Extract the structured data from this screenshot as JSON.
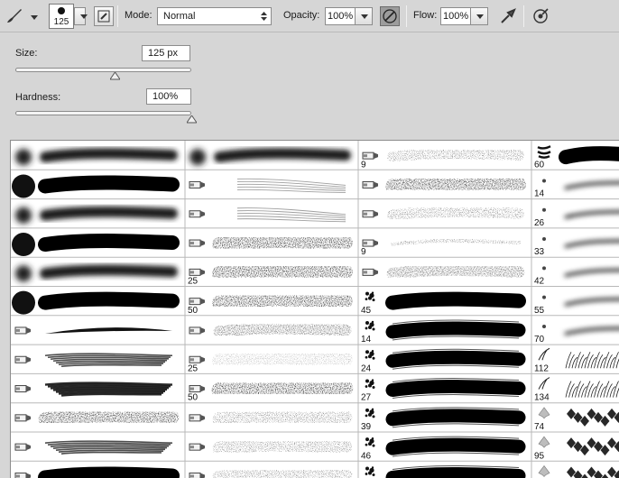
{
  "toolbar": {
    "brush_size": "125",
    "mode_label": "Mode:",
    "mode_value": "Normal",
    "opacity_label": "Opacity:",
    "opacity_value": "100%",
    "flow_label": "Flow:",
    "flow_value": "100%"
  },
  "panel": {
    "size_label": "Size:",
    "size_value": "125 px",
    "size_level": 125,
    "hardness_label": "Hardness:",
    "hardness_value": "100%",
    "hardness_level": 100
  },
  "brushes": {
    "columns": [
      [
        {
          "icon": "soft-round",
          "label": "",
          "stroke": "soft"
        },
        {
          "icon": "hard-round",
          "label": "",
          "stroke": "hard"
        },
        {
          "icon": "soft-round",
          "label": "",
          "stroke": "soft"
        },
        {
          "icon": "hard-round",
          "label": "",
          "stroke": "hard"
        },
        {
          "icon": "soft-round",
          "label": "",
          "stroke": "soft"
        },
        {
          "icon": "hard-round",
          "label": "",
          "stroke": "hard"
        },
        {
          "icon": "bristle-round",
          "label": "",
          "stroke": "taper"
        },
        {
          "icon": "bristle-flat",
          "label": "",
          "stroke": "streaky"
        },
        {
          "icon": "bristle-flat",
          "label": "",
          "stroke": "streaky-dark"
        },
        {
          "icon": "bristle-angle",
          "label": "",
          "stroke": "dry-dark"
        },
        {
          "icon": "bristle-fan",
          "label": "",
          "stroke": "streaky"
        },
        {
          "icon": "bristle-point",
          "label": "",
          "stroke": "hard"
        }
      ],
      [
        {
          "icon": "soft-round",
          "label": "",
          "stroke": "soft"
        },
        {
          "icon": "erodible-point",
          "label": "",
          "stroke": "faint-lines"
        },
        {
          "icon": "erodible-angle",
          "label": "",
          "stroke": "faint-lines"
        },
        {
          "icon": "airbrush",
          "label": "",
          "stroke": "rough"
        },
        {
          "icon": "airbrush",
          "label": "25",
          "stroke": "rough"
        },
        {
          "icon": "airbrush-angle",
          "label": "50",
          "stroke": "rough"
        },
        {
          "icon": "airbrush-angle",
          "label": "",
          "stroke": "light-rough"
        },
        {
          "icon": "airbrush-angle",
          "label": "25",
          "stroke": "speckle-light"
        },
        {
          "icon": "airbrush-angle",
          "label": "50",
          "stroke": "blotch"
        },
        {
          "icon": "airbrush-angle",
          "label": "",
          "stroke": "speckle"
        },
        {
          "icon": "airbrush-angle",
          "label": "",
          "stroke": "speckle"
        },
        {
          "icon": "airbrush-angle",
          "label": "",
          "stroke": "speckle"
        }
      ],
      [
        {
          "icon": "airbrush",
          "label": "9",
          "stroke": "textured"
        },
        {
          "icon": "airbrush",
          "label": "",
          "stroke": "rough"
        },
        {
          "icon": "airbrush",
          "label": "",
          "stroke": "textured"
        },
        {
          "icon": "airbrush",
          "label": "9",
          "stroke": "thin"
        },
        {
          "icon": "airbrush",
          "label": "",
          "stroke": "light-rough"
        },
        {
          "icon": "splatter",
          "label": "45",
          "stroke": "hard"
        },
        {
          "icon": "splatter",
          "label": "14",
          "stroke": "stroked-lines"
        },
        {
          "icon": "splatter",
          "label": "24",
          "stroke": "stroked-lines"
        },
        {
          "icon": "splatter",
          "label": "27",
          "stroke": "stroked-lines"
        },
        {
          "icon": "splatter",
          "label": "39",
          "stroke": "stroked-lines"
        },
        {
          "icon": "splatter",
          "label": "46",
          "stroke": "stroked-lines"
        },
        {
          "icon": "splatter",
          "label": "59",
          "stroke": "stroked-lines"
        }
      ],
      [
        {
          "icon": "texture",
          "label": "60",
          "stroke": "hard"
        },
        {
          "icon": "dot",
          "label": "14",
          "stroke": "thin-line"
        },
        {
          "icon": "dot",
          "label": "26",
          "stroke": "thin-line"
        },
        {
          "icon": "dot",
          "label": "33",
          "stroke": "thin-line"
        },
        {
          "icon": "dot",
          "label": "42",
          "stroke": "thin-line"
        },
        {
          "icon": "dot",
          "label": "55",
          "stroke": "thin-line"
        },
        {
          "icon": "dot",
          "label": "70",
          "stroke": "thin-line"
        },
        {
          "icon": "grass",
          "label": "112",
          "stroke": "grass"
        },
        {
          "icon": "grass",
          "label": "134",
          "stroke": "grass"
        },
        {
          "icon": "leaf",
          "label": "74",
          "stroke": "leaves"
        },
        {
          "icon": "leaf",
          "label": "95",
          "stroke": "leaves"
        },
        {
          "icon": "leaf",
          "label": "",
          "stroke": "leaves"
        }
      ]
    ]
  }
}
